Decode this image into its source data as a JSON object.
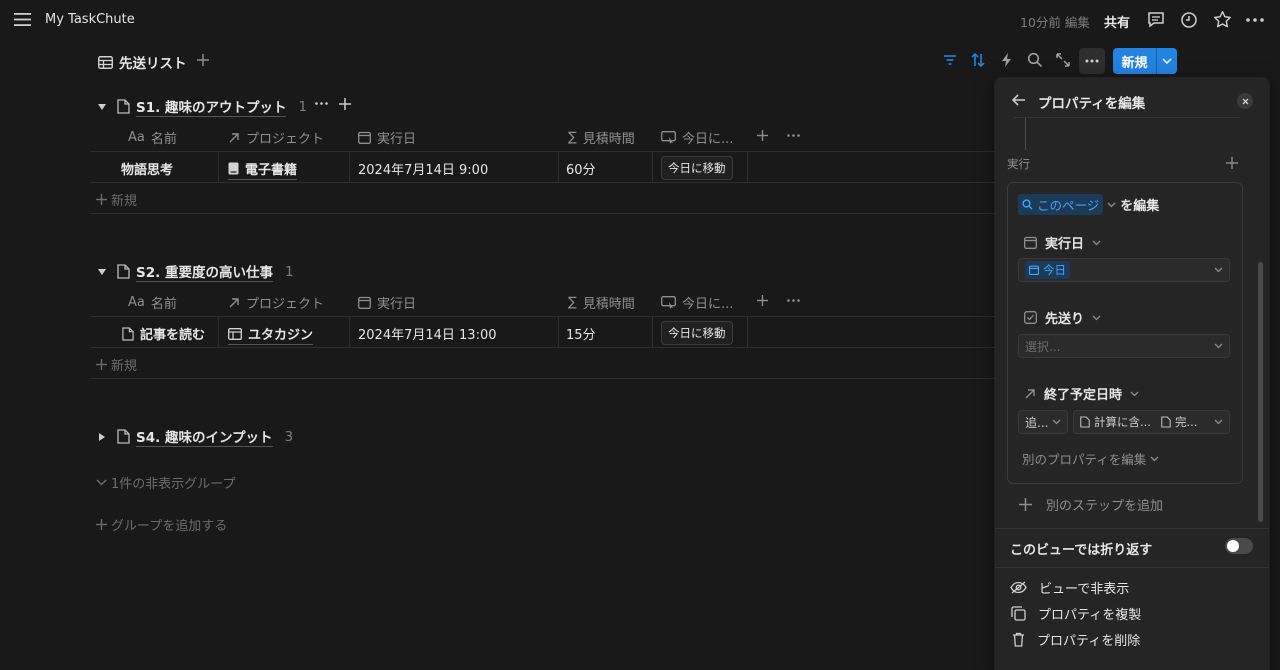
{
  "topbar": {
    "title": "My TaskChute",
    "edited": "10分前 編集",
    "share": "共有"
  },
  "view": {
    "tab_label": "先送リスト",
    "new_button": "新規"
  },
  "columns": {
    "name": "名前",
    "name_prefix": "Aa",
    "project": "プロジェクト",
    "date": "実行日",
    "estimate": "見積時間",
    "today": "今日に..."
  },
  "groups": [
    {
      "title": "S1. 趣味のアウトプット",
      "count": "1",
      "row": {
        "name": "物語思考",
        "project": "電子書籍",
        "date": "2024年7月14日 9:00",
        "estimate": "60分",
        "button": "今日に移動"
      },
      "new_label": "新規"
    },
    {
      "title": "S2. 重要度の高い仕事",
      "count": "1",
      "row": {
        "name": "記事を読む",
        "project": "ユタカジン",
        "date": "2024年7月14日 13:00",
        "estimate": "15分",
        "button": "今日に移動"
      },
      "new_label": "新規"
    },
    {
      "title": "S4. 趣味のインプット",
      "count": "3"
    }
  ],
  "hidden_groups": "1件の非表示グループ",
  "add_group": "グループを追加する",
  "panel": {
    "title": "プロパティを編集",
    "section": "実行",
    "this_page": "このページ",
    "edit_suffix": "を編集",
    "prop1": {
      "label": "実行日",
      "value": "今日"
    },
    "prop2": {
      "label": "先送り",
      "placeholder": "選択..."
    },
    "prop3": {
      "label": "終了予定日時",
      "sel1": "追...",
      "sel2": "計算に含...",
      "sel3": "完..."
    },
    "edit_other": "別のプロパティを編集",
    "add_step": "別のステップを追加",
    "wrap_label": "このビューでは折り返す",
    "wrap_on": false,
    "hide": "ビューで非表示",
    "duplicate": "プロパティを複製",
    "delete": "プロパティを削除"
  },
  "colors": {
    "background": "#191919",
    "accent": "#2383e2",
    "panel": "#252525"
  }
}
